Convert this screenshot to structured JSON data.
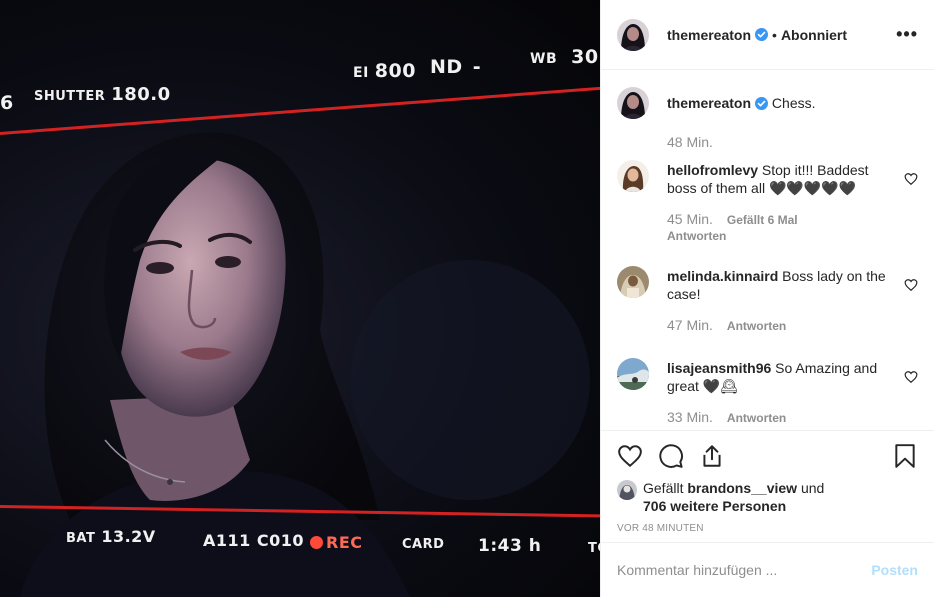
{
  "colors": {
    "accent": "#0095f6",
    "rec_red": "#ff4a3a",
    "frame_line": "#d32222",
    "muted": "#8e8e8e"
  },
  "photo": {
    "hud": {
      "iso_fragment": "6",
      "shutter_label": "SHUTTER",
      "shutter_value": "180.0",
      "ei_label": "EI",
      "ei_value": "800",
      "nd_label": "ND",
      "nd_value": "-",
      "wb_label": "WB",
      "wb_value": "30",
      "bat_label": "BAT",
      "bat_value": "13.2V",
      "clip_id": "A111 C010",
      "rec_label": "REC",
      "card_label": "CARD",
      "card_value": "1:43 h",
      "tc_fragment": "TC"
    }
  },
  "header": {
    "username": "themereaton",
    "verified_icon": "verified-badge-icon",
    "separator": "•",
    "follow_state": "Abonniert",
    "more_icon": "more-options-icon",
    "more_glyph": "•••"
  },
  "caption": {
    "username": "themereaton",
    "text": "Chess.",
    "time": "48 Min."
  },
  "comments": [
    {
      "username": "hellofromlevy",
      "text": "Stop it!!! Baddest boss of them all 🖤🖤🖤🖤🖤",
      "time": "45 Min.",
      "likes": "Gefällt 6 Mal",
      "reply": "Antworten"
    },
    {
      "username": "melinda.kinnaird",
      "text": "Boss lady on the case!",
      "time": "47 Min.",
      "reply": "Antworten"
    },
    {
      "username": "lisajeansmith96",
      "text": "So Amazing and great 🖤🕰",
      "time": "33 Min.",
      "reply": "Antworten"
    }
  ],
  "actions": {
    "like_icon": "heart-icon",
    "comment_icon": "comment-icon",
    "share_icon": "share-icon",
    "save_icon": "bookmark-icon"
  },
  "likes": {
    "prefix": "Gefällt",
    "user": "brandons__view",
    "connector": "und",
    "others": "706 weitere Personen"
  },
  "timestamp": "VOR 48 MINUTEN",
  "composer": {
    "placeholder": "Kommentar hinzufügen ...",
    "post_label": "Posten"
  }
}
